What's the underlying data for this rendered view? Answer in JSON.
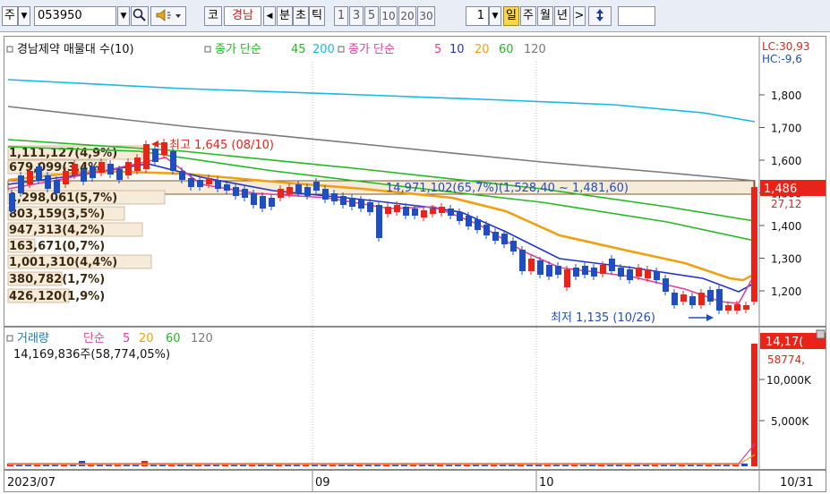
{
  "toolbar": {
    "market_select": "주",
    "dropdown_arrow": "▼",
    "code_value": "053950",
    "search_icon": "search-icon",
    "speaker_icon": "speaker-icon",
    "market_badge": "코",
    "stock_name": "경남",
    "prev_arrow": "◀",
    "period_min": "분",
    "period_tick": "초",
    "period_tick2": "틱",
    "period_buttons": [
      "1",
      "3",
      "5",
      "10",
      "20",
      "30"
    ],
    "period_count": "1",
    "period_day": "일",
    "period_week": "주",
    "period_month": "월",
    "period_year": "년",
    "next_arrow": ">",
    "updown_icon": "up-down-arrow-icon"
  },
  "price_legend": {
    "title": "경남제약 매물대 수(10)",
    "ma_long_label": "종가 단순",
    "ma_long_values": [
      "45",
      "200"
    ],
    "ma_short_label": "종가 단순",
    "ma_short_values": [
      "5",
      "10",
      "20",
      "60",
      "120"
    ]
  },
  "price_axis": {
    "lc_label": "LC:30,93",
    "hc_label": "HC:-9,6",
    "ticks": [
      "1,800",
      "1,700",
      "1,600",
      "1,500",
      "1,400",
      "1,300",
      "1,200"
    ],
    "current_price": "1,486",
    "change": "27,12"
  },
  "annotations": {
    "high": "최고 1,645 (08/10)",
    "low": "최저 1,135 (10/26)",
    "range_box": "14,971,102(65,7%)(1,528,40 ~ 1,481,60)"
  },
  "volume_profile": [
    "1,111,127(4,9%)",
    "679,099(3,4%)",
    "1,298,061(5,7%)",
    "803,159(3,5%)",
    "947,313(4,2%)",
    "163,671(0,7%)",
    "1,001,310(4,4%)",
    "380,782(1,7%)",
    "426,120(1,9%)"
  ],
  "volume_legend": {
    "title": "거래량",
    "ma_label": "단순",
    "ma_values": [
      "5",
      "20",
      "60",
      "120"
    ],
    "summary": "14,169,836주(58,774,05%)"
  },
  "volume_axis": {
    "ticks": [
      "10,000K",
      "5,000K"
    ],
    "current_volume": "14,17(",
    "current_ratio": "58774,"
  },
  "x_axis": {
    "labels": [
      "2023/07",
      "09",
      "10"
    ],
    "end_label": "10/31"
  },
  "colors": {
    "up": "#e8231a",
    "down": "#1f4fbf",
    "ma5": "#e040a0",
    "ma10": "#2432c8",
    "ma20": "#f0a010",
    "ma60": "#24b824",
    "ma120": "#7a7a7a",
    "ma200": "#18b8e8"
  }
}
